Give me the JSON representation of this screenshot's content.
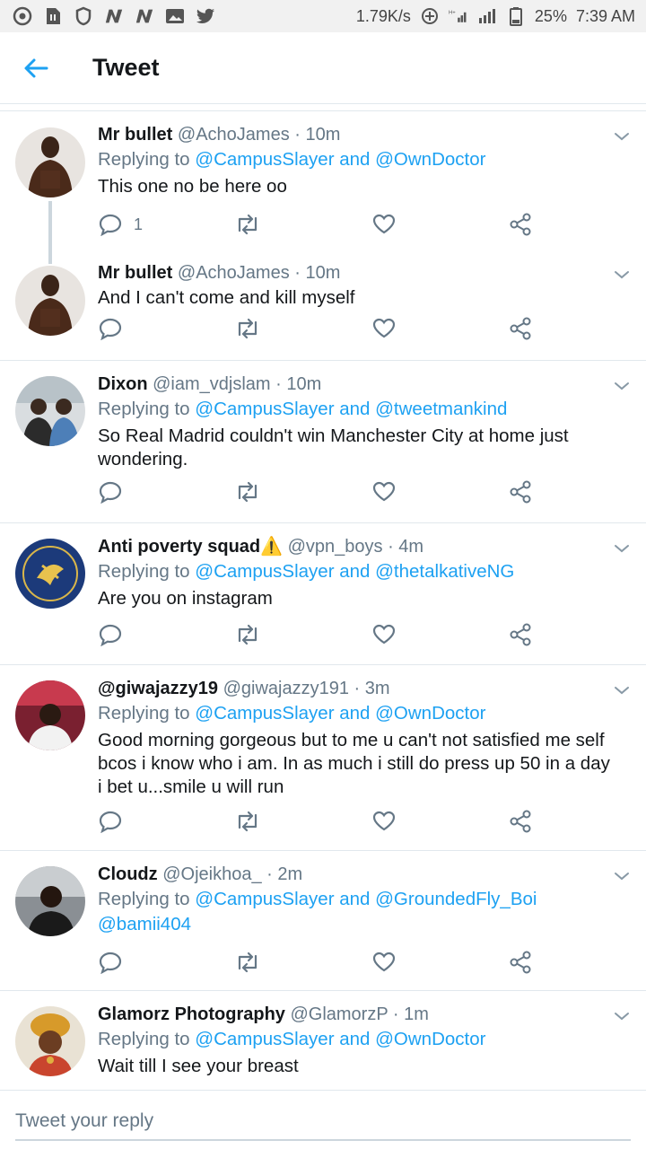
{
  "status_bar": {
    "net_speed": "1.79K/s",
    "battery": "25%",
    "time": "7:39 AM",
    "icons": [
      "chrome-icon",
      "sim-icon",
      "shield-icon",
      "n-app-icon",
      "n-app-icon",
      "gallery-icon",
      "twitter-bird-icon",
      "data-saver-icon",
      "signal-icon",
      "signal-icon",
      "battery-icon"
    ]
  },
  "header": {
    "title": "Tweet",
    "back_icon": "back-arrow-icon"
  },
  "colors": {
    "link": "#1da1f2",
    "muted": "#657786",
    "text": "#14171a",
    "divider": "#e1e8ed"
  },
  "tweets": [
    {
      "name": "Mr bullet",
      "handle": "@AchoJames",
      "time": "· 10m",
      "replying_label": "Replying to",
      "mentions": "@CampusSlayer and @OwnDoctor",
      "text": "This one no be here oo",
      "reply_count": "1"
    },
    {
      "name": "Mr bullet",
      "handle": "@AchoJames",
      "time": "· 10m",
      "text": "And I can't come and kill myself"
    },
    {
      "name": "Dixon",
      "handle": "@iam_vdjslam",
      "time": "· 10m",
      "replying_label": "Replying to",
      "mentions": "@CampusSlayer and @tweetmankind",
      "text": "So Real Madrid couldn't win Manchester City at home just wondering."
    },
    {
      "name": "Anti poverty squad⚠️",
      "handle": "@vpn_boys",
      "time": "· 4m",
      "replying_label": "Replying to",
      "mentions": "@CampusSlayer and @thetalkativeNG",
      "text": "Are you on instagram"
    },
    {
      "name": "@giwajazzy19",
      "handle": "@giwajazzy191",
      "time": "· 3m",
      "replying_label": "Replying to",
      "mentions": "@CampusSlayer and @OwnDoctor",
      "text": "Good morning gorgeous but to me u can't not satisfied me self bcos i know who i am. In as much i still do press up 50 in a day i bet u...smile u will run"
    },
    {
      "name": "Cloudz",
      "handle": "@Ojeikhoa_",
      "time": "· 2m",
      "replying_label": "Replying to",
      "mentions": "@CampusSlayer and @GroundedFly_Boi",
      "mentions2": "@bamii404",
      "text": ""
    },
    {
      "name": "Glamorz Photography",
      "handle": "@GlamorzP",
      "time": "· 1m",
      "replying_label": "Replying to",
      "mentions": "@CampusSlayer and @OwnDoctor",
      "text": "Wait till I see your breast"
    }
  ],
  "reply_box": {
    "placeholder": "Tweet your reply"
  }
}
